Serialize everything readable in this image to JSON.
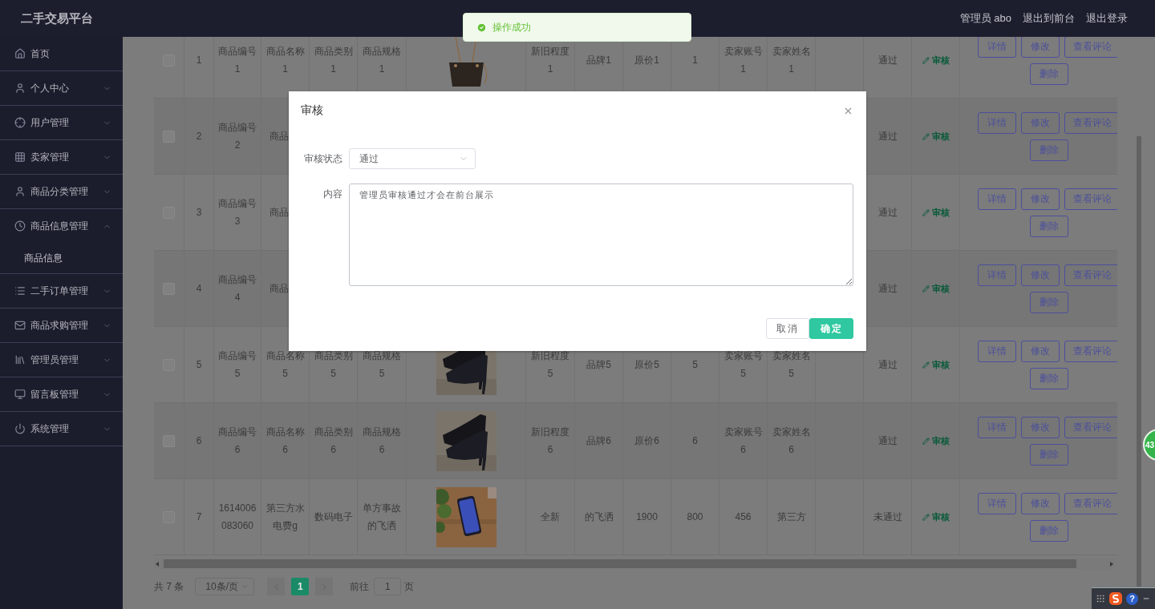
{
  "header": {
    "title": "二手交易平台",
    "user": "管理员 abo",
    "links": [
      "退出到前台",
      "退出登录"
    ]
  },
  "toast": {
    "message": "操作成功"
  },
  "sidebar": {
    "items": [
      {
        "label": "首页",
        "kind": "link"
      },
      {
        "label": "个人中心",
        "kind": "menu",
        "expanded": false
      },
      {
        "label": "用户管理",
        "kind": "menu",
        "expanded": false
      },
      {
        "label": "卖家管理",
        "kind": "menu",
        "expanded": false
      },
      {
        "label": "商品分类管理",
        "kind": "menu",
        "expanded": false
      },
      {
        "label": "商品信息管理",
        "kind": "menu",
        "expanded": true,
        "children": [
          {
            "label": "商品信息"
          }
        ]
      },
      {
        "label": "二手订单管理",
        "kind": "menu",
        "expanded": false
      },
      {
        "label": "商品求购管理",
        "kind": "menu",
        "expanded": false
      },
      {
        "label": "管理员管理",
        "kind": "menu",
        "expanded": false
      },
      {
        "label": "留言板管理",
        "kind": "menu",
        "expanded": false
      },
      {
        "label": "系统管理",
        "kind": "menu",
        "expanded": false
      }
    ]
  },
  "table": {
    "rows": [
      {
        "kind": "full",
        "checked": false,
        "index": "1",
        "cells": [
          "商品编号1",
          "商品名称1",
          "商品类别1",
          "商品规格1",
          {
            "kind": "picture"
          },
          "新旧程度1",
          "品牌1",
          "原价1",
          "1",
          "卖家账号1",
          "卖家姓名1"
        ],
        "status": "通过",
        "audit": "审核",
        "actions": [
          "详情",
          "修改",
          "查看评论",
          "删除"
        ]
      },
      {
        "kind": "partial",
        "checked": false,
        "index": "2",
        "cells": [
          "商品编号2",
          "商品"
        ],
        "status": "通过",
        "audit": "审核",
        "actions": [
          "详情",
          "修改",
          "查看评论",
          "删除"
        ]
      },
      {
        "kind": "partial",
        "checked": false,
        "index": "3",
        "cells": [
          "商品编号3",
          "商品"
        ],
        "status": "通过",
        "audit": "审核",
        "actions": [
          "详情",
          "修改",
          "查看评论",
          "删除"
        ]
      },
      {
        "kind": "partial",
        "checked": false,
        "index": "4",
        "cells": [
          "商品编号4",
          "商品"
        ],
        "status": "通过",
        "audit": "审核",
        "actions": [
          "详情",
          "修改",
          "查看评论",
          "删除"
        ]
      },
      {
        "kind": "full",
        "checked": false,
        "index": "5",
        "cells": [
          "商品编号5",
          "商品名称5",
          "商品类别5",
          "商品规格5",
          {
            "kind": "picture"
          },
          "新旧程度5",
          "品牌5",
          "原价5",
          "5",
          "卖家账号5",
          "卖家姓名5"
        ],
        "status": "通过",
        "audit": "审核",
        "actions": [
          "详情",
          "修改",
          "查看评论",
          "删除"
        ]
      },
      {
        "kind": "full",
        "checked": false,
        "index": "6",
        "cells": [
          "商品编号6",
          "商品名称6",
          "商品类别6",
          "商品规格6",
          {
            "kind": "picture"
          },
          "新旧程度6",
          "品牌6",
          "原价6",
          "6",
          "卖家账号6",
          "卖家姓名6"
        ],
        "status": "通过",
        "audit": "审核",
        "actions": [
          "详情",
          "修改",
          "查看评论",
          "删除"
        ]
      },
      {
        "kind": "full",
        "checked": false,
        "index": "7",
        "cells": [
          "1614006083060",
          "第三方水电费g",
          "数码电子",
          "单方事故的飞洒",
          {
            "kind": "picture"
          },
          "全新",
          "的飞洒",
          "1900",
          "800",
          "456",
          "第三方"
        ],
        "status": "未通过",
        "audit": "审核",
        "actions": [
          "详情",
          "修改",
          "查看评论",
          "删除"
        ]
      }
    ]
  },
  "pagination": {
    "total": "共 7 条",
    "page_size": "10条/页",
    "pages": [
      {
        "label": "1",
        "selected": true
      }
    ],
    "goto_label": "前往",
    "goto_value": "1",
    "goto_suffix": "页"
  },
  "dialog": {
    "title": "审核",
    "fields": [
      {
        "label": "审核状态",
        "kind": "select",
        "value": "通过"
      },
      {
        "label": "内容",
        "kind": "textarea",
        "value": "管理员审核通过才会在前台展示"
      }
    ],
    "buttons": [
      {
        "label": "取消",
        "kind": "default"
      },
      {
        "label": "确定",
        "kind": "primary"
      }
    ]
  },
  "float_ball": {
    "label": "43"
  },
  "ime_bar": {
    "help": "?"
  }
}
